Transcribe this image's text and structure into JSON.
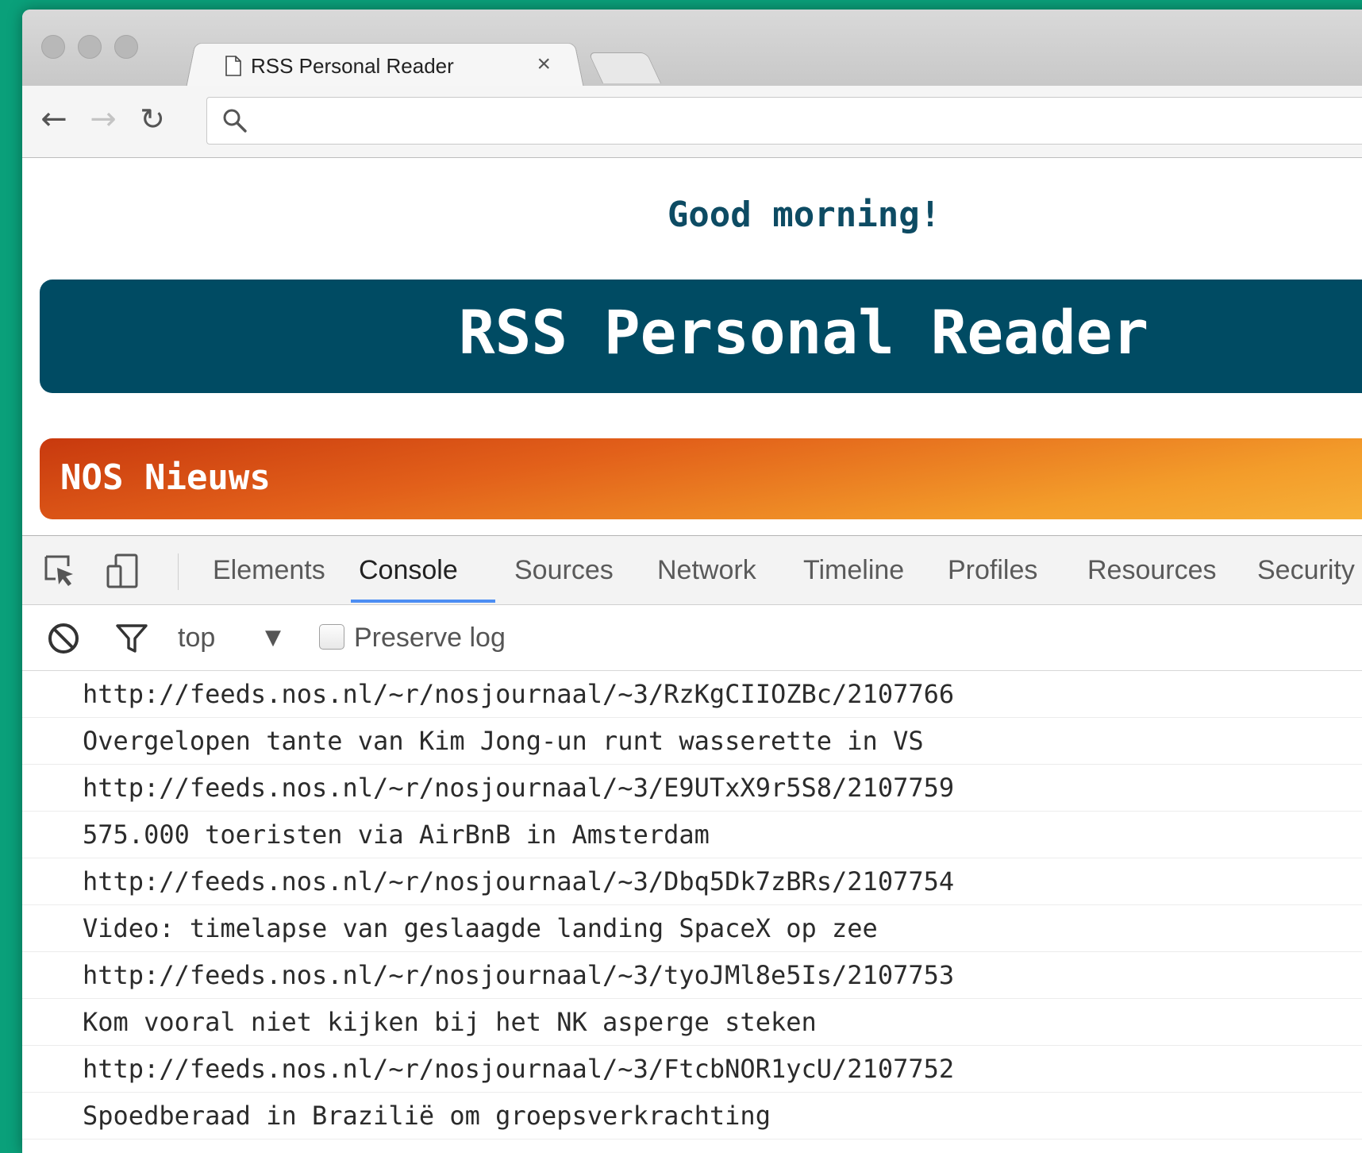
{
  "browser": {
    "tab_title": "RSS Personal Reader",
    "tab_close": "×",
    "omnibox_value": ""
  },
  "page": {
    "greeting": "Good morning!",
    "header_title": "RSS Personal Reader",
    "feed_title": "NOS Nieuws"
  },
  "devtools": {
    "tabs": [
      "Elements",
      "Console",
      "Sources",
      "Network",
      "Timeline",
      "Profiles",
      "Resources",
      "Security"
    ],
    "active_tab": "Console",
    "context": "top",
    "context_arrow": "▼",
    "preserve_log": "Preserve log",
    "console_lines": [
      "http://feeds.nos.nl/~r/nosjournaal/~3/RzKgCIIOZBc/2107766",
      "Overgelopen tante van Kim Jong-un runt wasserette in VS",
      "http://feeds.nos.nl/~r/nosjournaal/~3/E9UTxX9r5S8/2107759",
      "575.000 toeristen via AirBnB in Amsterdam",
      "http://feeds.nos.nl/~r/nosjournaal/~3/Dbq5Dk7zBRs/2107754",
      "Video: timelapse van geslaagde landing SpaceX op zee",
      "http://feeds.nos.nl/~r/nosjournaal/~3/tyoJMl8e5Is/2107753",
      "Kom vooral niet kijken bij het NK asperge steken",
      "http://feeds.nos.nl/~r/nosjournaal/~3/FtcbNOR1ycU/2107752",
      "Spoedberaad in Brazilië om groepsverkrachting"
    ]
  },
  "icons": {
    "back": "←",
    "forward": "→",
    "reload": "↻"
  },
  "colors": {
    "background": "#0aa07a",
    "header": "#004b63",
    "greeting": "#0d4b63",
    "feed_start": "#c8390e",
    "feed_end": "#f7b33a",
    "active_tab_underline": "#4d8ef3"
  }
}
